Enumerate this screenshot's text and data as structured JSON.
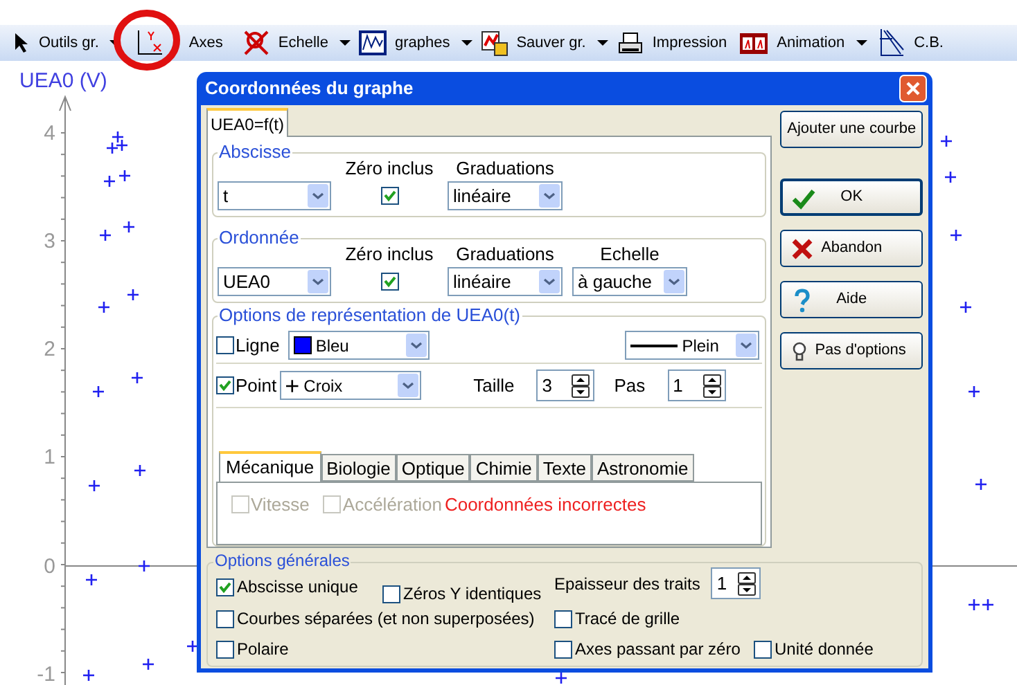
{
  "toolbar": [
    {
      "label": "Outils gr.",
      "dropdown": true
    },
    {
      "label": "Axes",
      "dropdown": false
    },
    {
      "label": "Echelle",
      "dropdown": true
    },
    {
      "label": "graphes",
      "dropdown": true
    },
    {
      "label": "Sauver gr.",
      "dropdown": true
    },
    {
      "label": "Impression",
      "dropdown": false
    },
    {
      "label": "Animation",
      "dropdown": true
    },
    {
      "label": "C.B.",
      "dropdown": false
    }
  ],
  "graph": {
    "y_axis_label": "UEA0 (V)",
    "y_ticks": [
      "4",
      "3",
      "2",
      "1",
      "0",
      "-1"
    ]
  },
  "dialog": {
    "title": "Coordonnées du graphe",
    "tabs": [
      {
        "label": "UEA0=f(t)",
        "selected": true
      }
    ],
    "abscisse": {
      "title": "Abscisse",
      "zero_label": "Zéro inclus",
      "zero_checked": true,
      "grad_label": "Graduations",
      "variable": "t",
      "graduation": "linéaire"
    },
    "ordonnee": {
      "title": "Ordonnée",
      "zero_label": "Zéro inclus",
      "zero_checked": true,
      "grad_label": "Graduations",
      "variable": "UEA0",
      "graduation": "linéaire",
      "scale_label": "Echelle",
      "scale": "à gauche"
    },
    "representation": {
      "title": "Options de représentation de UEA0(t)",
      "line": {
        "label": "Ligne",
        "checked": false,
        "color_name": "Bleu",
        "color": "#0000ff",
        "style": "Plein"
      },
      "point": {
        "label": "Point",
        "checked": true,
        "symbol": "+",
        "shape": "Croix",
        "size_label": "Taille",
        "size": "3",
        "step_label": "Pas",
        "step": "1"
      },
      "tabs": [
        {
          "label": "Mécanique",
          "selected": true
        },
        {
          "label": "Biologie",
          "selected": false
        },
        {
          "label": "Optique",
          "selected": false
        },
        {
          "label": "Chimie",
          "selected": false
        },
        {
          "label": "Texte",
          "selected": false
        },
        {
          "label": "Astronomie",
          "selected": false
        }
      ],
      "options": [
        {
          "label": "Vitesse",
          "checked": false,
          "disabled": true
        },
        {
          "label": "Accélération",
          "checked": false,
          "disabled": true
        }
      ],
      "error": "Coordonnées incorrectes"
    },
    "buttons": [
      {
        "label": "Ajouter une courbe"
      },
      {
        "label": "OK"
      },
      {
        "label": "Abandon"
      },
      {
        "label": "Aide"
      },
      {
        "label": "Pas d'options"
      }
    ],
    "general": {
      "title": "Options générales",
      "thickness_label": "Epaisseur des traits",
      "thickness": "1",
      "options": [
        {
          "label": "Abscisse unique",
          "checked": true
        },
        {
          "label": "Zéros Y identiques",
          "checked": false
        },
        {
          "label": "Courbes séparées (et non superposées)",
          "checked": false
        },
        {
          "label": "Tracé de grille",
          "checked": false
        },
        {
          "label": "Polaire",
          "checked": false
        },
        {
          "label": "Axes passant par zéro",
          "checked": false
        },
        {
          "label": "Unité donnée",
          "checked": false
        }
      ]
    }
  }
}
